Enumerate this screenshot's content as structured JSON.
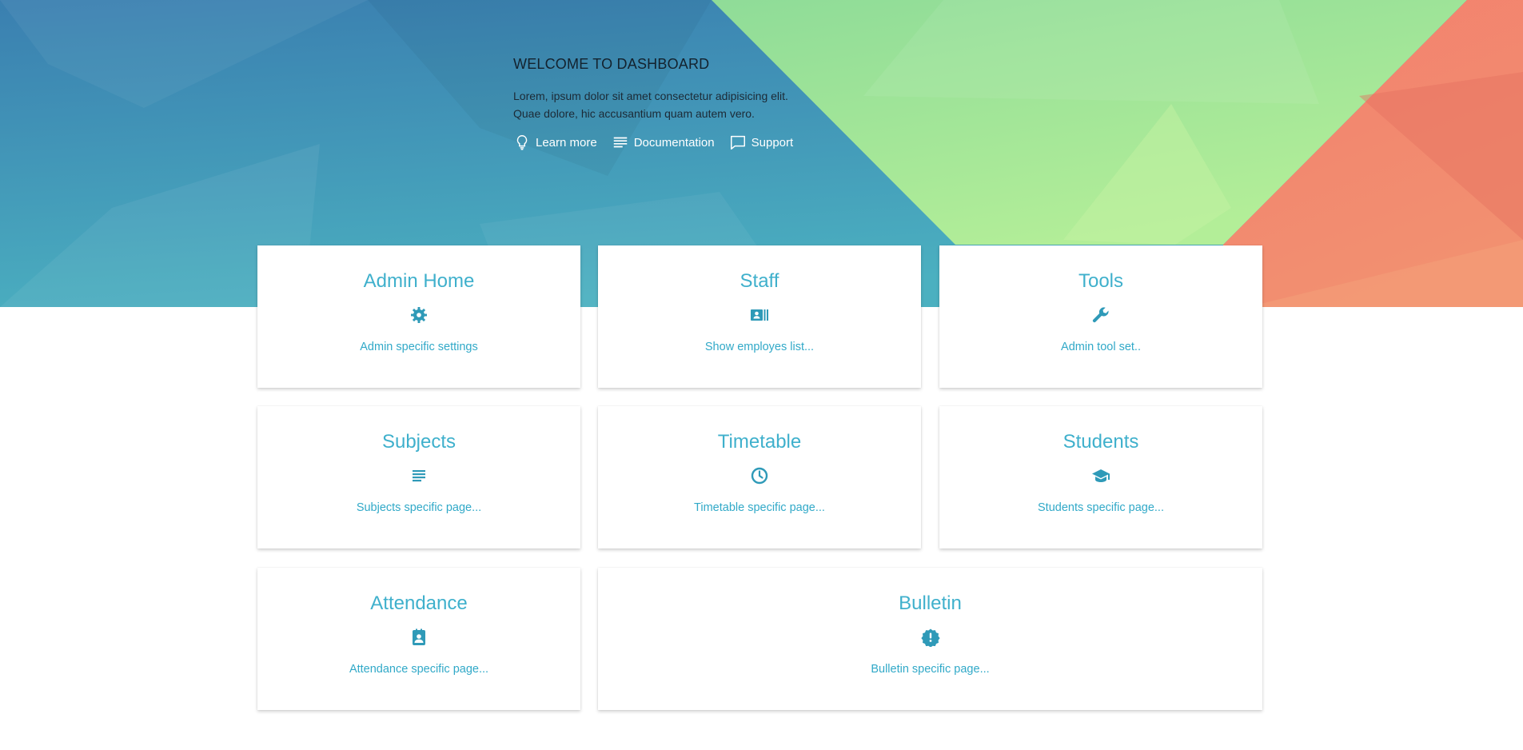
{
  "hero": {
    "title": "WELCOME TO DASHBOARD",
    "desc_line1": "Lorem, ipsum dolor sit amet consectetur adipisicing elit.",
    "desc_line2": "Quae dolore, hic accusantium quam autem vero.",
    "links": [
      {
        "label": "Learn more",
        "icon": "lightbulb-icon"
      },
      {
        "label": "Documentation",
        "icon": "notes-icon"
      },
      {
        "label": "Support",
        "icon": "chat-icon"
      }
    ]
  },
  "cards": [
    {
      "title": "Admin Home",
      "icon": "gear-icon",
      "desc": "Admin specific settings"
    },
    {
      "title": "Staff",
      "icon": "contact-card-icon",
      "desc": "Show employes list..."
    },
    {
      "title": "Tools",
      "icon": "wrench-icon",
      "desc": "Admin tool set.."
    },
    {
      "title": "Subjects",
      "icon": "list-icon",
      "desc": "Subjects specific page..."
    },
    {
      "title": "Timetable",
      "icon": "clock-icon",
      "desc": "Timetable specific page..."
    },
    {
      "title": "Students",
      "icon": "graduation-cap-icon",
      "desc": "Students specific page..."
    },
    {
      "title": "Attendance",
      "icon": "attendance-badge-icon",
      "desc": "Attendance specific page..."
    },
    {
      "title": "Bulletin",
      "icon": "alert-badge-icon",
      "desc": "Bulletin specific page..."
    }
  ],
  "colors": {
    "accent": "#3fb0cc",
    "hero_blue": "#3a86b0",
    "hero_green": "#9be09a",
    "hero_coral": "#f08a6e"
  }
}
